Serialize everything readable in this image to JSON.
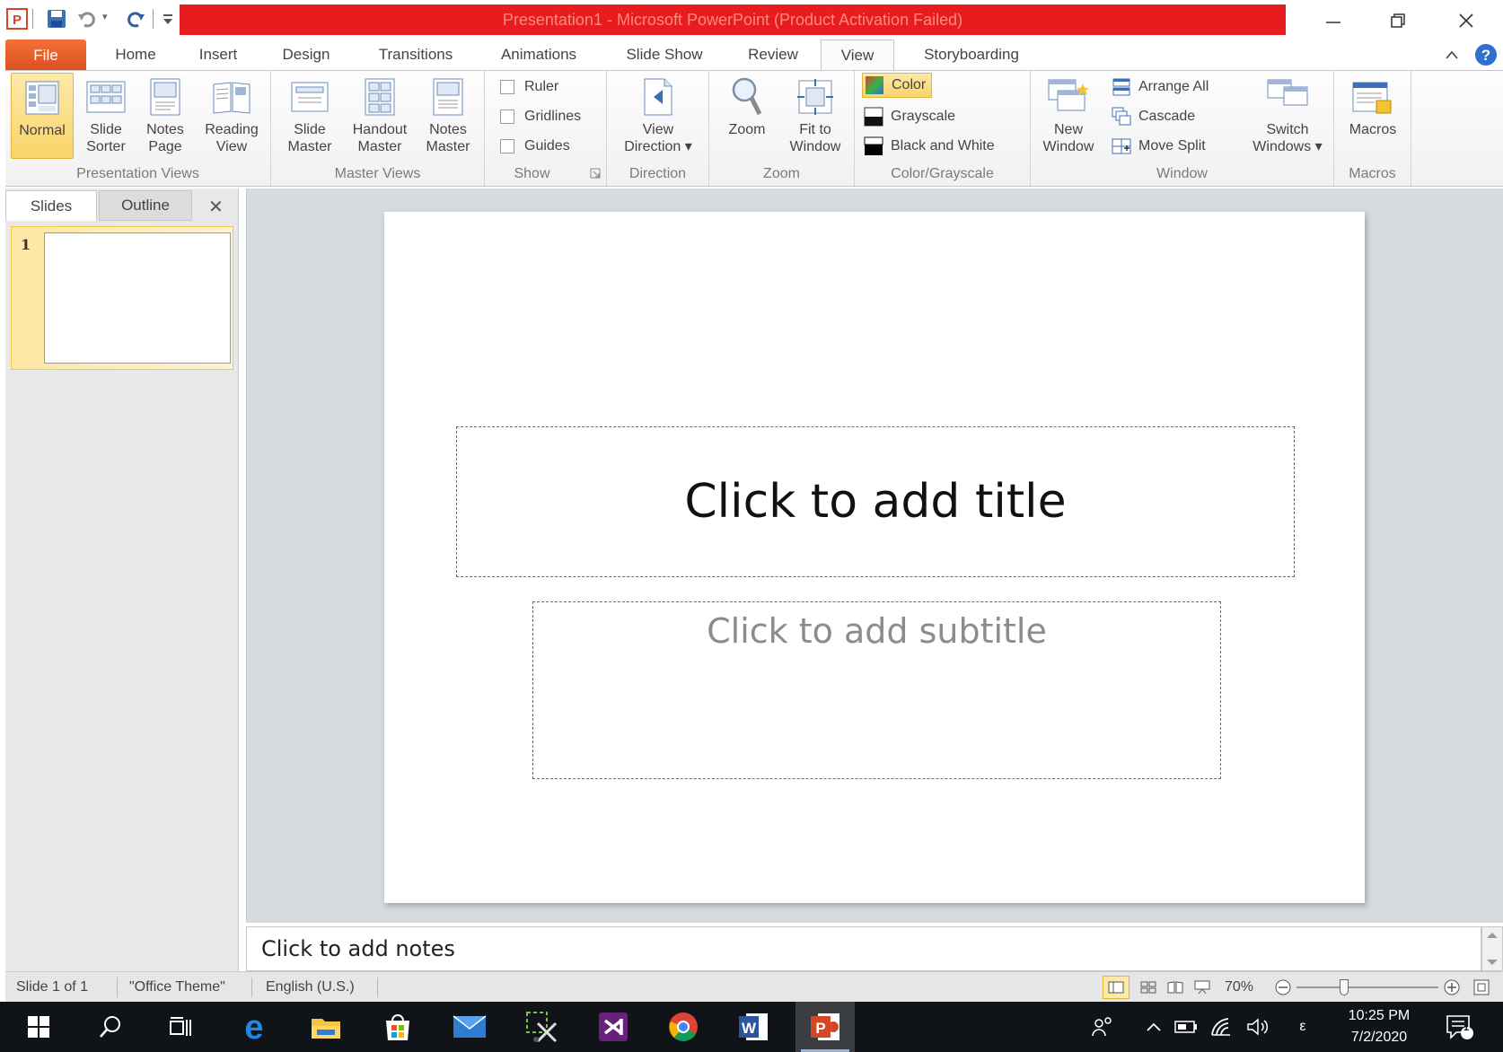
{
  "window": {
    "title": "Presentation1  -  Microsoft PowerPoint (Product Activation Failed)",
    "title_bar_color": "#e81c1c",
    "app_icon": "powerpoint-icon",
    "qat": [
      "save-icon",
      "undo-icon",
      "redo-icon",
      "customize-qat-icon"
    ],
    "controls": [
      "minimize-icon",
      "restore-icon",
      "close-icon"
    ]
  },
  "tabs": [
    "File",
    "Home",
    "Insert",
    "Design",
    "Transitions",
    "Animations",
    "Slide Show",
    "Review",
    "View",
    "Storyboarding"
  ],
  "active_tab": "View",
  "ribbon": {
    "presentation_views": {
      "label": "Presentation Views",
      "normal": "Normal",
      "slide_sorter": [
        "Slide",
        "Sorter"
      ],
      "notes_page": [
        "Notes",
        "Page"
      ],
      "reading_view": [
        "Reading",
        "View"
      ]
    },
    "master_views": {
      "label": "Master Views",
      "slide_master": [
        "Slide",
        "Master"
      ],
      "handout_master": [
        "Handout",
        "Master"
      ],
      "notes_master": [
        "Notes",
        "Master"
      ]
    },
    "show": {
      "label": "Show",
      "ruler": "Ruler",
      "gridlines": "Gridlines",
      "guides": "Guides",
      "ruler_checked": false,
      "gridlines_checked": false,
      "guides_checked": false
    },
    "direction": {
      "label": "Direction",
      "view_direction": [
        "View",
        "Direction"
      ]
    },
    "zoom": {
      "label": "Zoom",
      "zoom": "Zoom",
      "fit_to_window": [
        "Fit to",
        "Window"
      ]
    },
    "color_grayscale": {
      "label": "Color/Grayscale",
      "color": "Color",
      "grayscale": "Grayscale",
      "black_and_white": "Black and White"
    },
    "window": {
      "label": "Window",
      "new_window": [
        "New",
        "Window"
      ],
      "arrange_all": "Arrange All",
      "cascade": "Cascade",
      "move_split": "Move Split",
      "switch_windows": [
        "Switch",
        "Windows"
      ]
    },
    "macros": {
      "label": "Macros",
      "macros": "Macros"
    }
  },
  "pane": {
    "tabs": [
      "Slides",
      "Outline"
    ],
    "active_tab": "Slides",
    "slide_number": "1"
  },
  "slide": {
    "title_placeholder": "Click to add title",
    "subtitle_placeholder": "Click to add subtitle"
  },
  "notes": {
    "placeholder": "Click to add notes"
  },
  "status": {
    "slide_count": "Slide 1 of 1",
    "theme": "\"Office Theme\"",
    "language": "English (U.S.)",
    "zoom": "70%",
    "zoom_level": 0.7
  },
  "taskbar": {
    "apps": [
      "windows-start-icon",
      "search-icon",
      "task-view-icon",
      "edge-icon",
      "file-explorer-icon",
      "store-icon",
      "mail-icon",
      "snipping-tool-icon",
      "visual-studio-icon",
      "chrome-icon",
      "word-icon",
      "powerpoint-icon"
    ],
    "time": "10:25 PM",
    "date": "7/2/2020",
    "ime": "ε",
    "notification_count": "1"
  }
}
